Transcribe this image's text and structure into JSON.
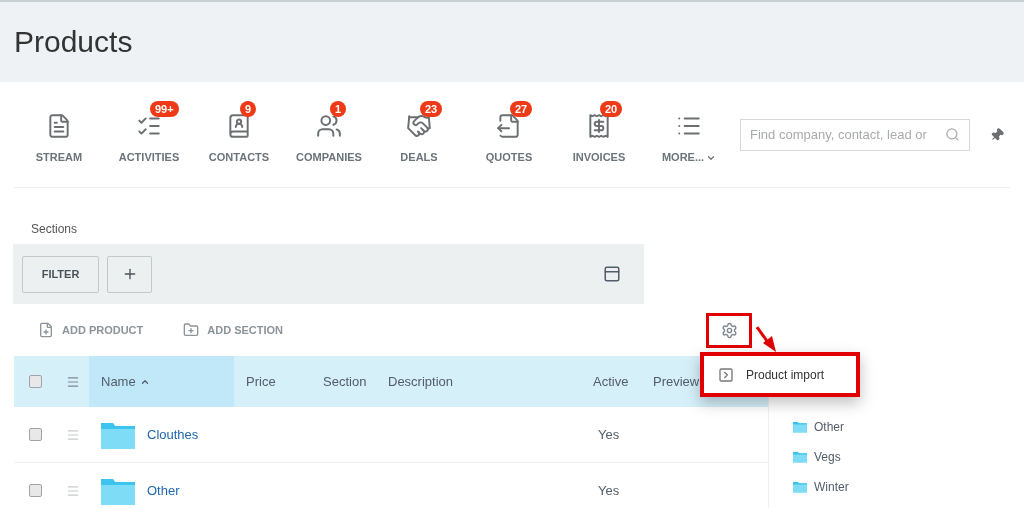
{
  "page": {
    "title": "Products"
  },
  "nav": [
    {
      "label": "STREAM"
    },
    {
      "label": "ACTIVITIES",
      "badge": "99+"
    },
    {
      "label": "CONTACTS",
      "badge": "9"
    },
    {
      "label": "COMPANIES",
      "badge": "1"
    },
    {
      "label": "DEALS",
      "badge": "23"
    },
    {
      "label": "QUOTES",
      "badge": "27"
    },
    {
      "label": "INVOICES",
      "badge": "20"
    },
    {
      "label": "MORE..."
    }
  ],
  "search": {
    "placeholder": "Find company, contact, lead or"
  },
  "sections": {
    "label": "Sections",
    "filter_button": "FILTER"
  },
  "actions": [
    "ADD PRODUCT",
    "ADD SECTION"
  ],
  "table": {
    "select_all_checked": false,
    "columns": [
      {
        "label": "Name",
        "sorted": true
      },
      {
        "label": "Price",
        "sorted": false
      },
      {
        "label": "Section",
        "sorted": false
      },
      {
        "label": "Description",
        "sorted": false
      },
      {
        "label": "Active",
        "sorted": false
      },
      {
        "label": "Preview",
        "sorted": false
      }
    ],
    "rows": [
      {
        "name": "Clouthes",
        "active": "Yes",
        "checked": false
      },
      {
        "name": "Other",
        "active": "Yes",
        "checked": false
      }
    ]
  },
  "menu": {
    "items": [
      "Product import"
    ]
  },
  "section_tree": [
    "Other",
    "Vegs",
    "Winter"
  ]
}
